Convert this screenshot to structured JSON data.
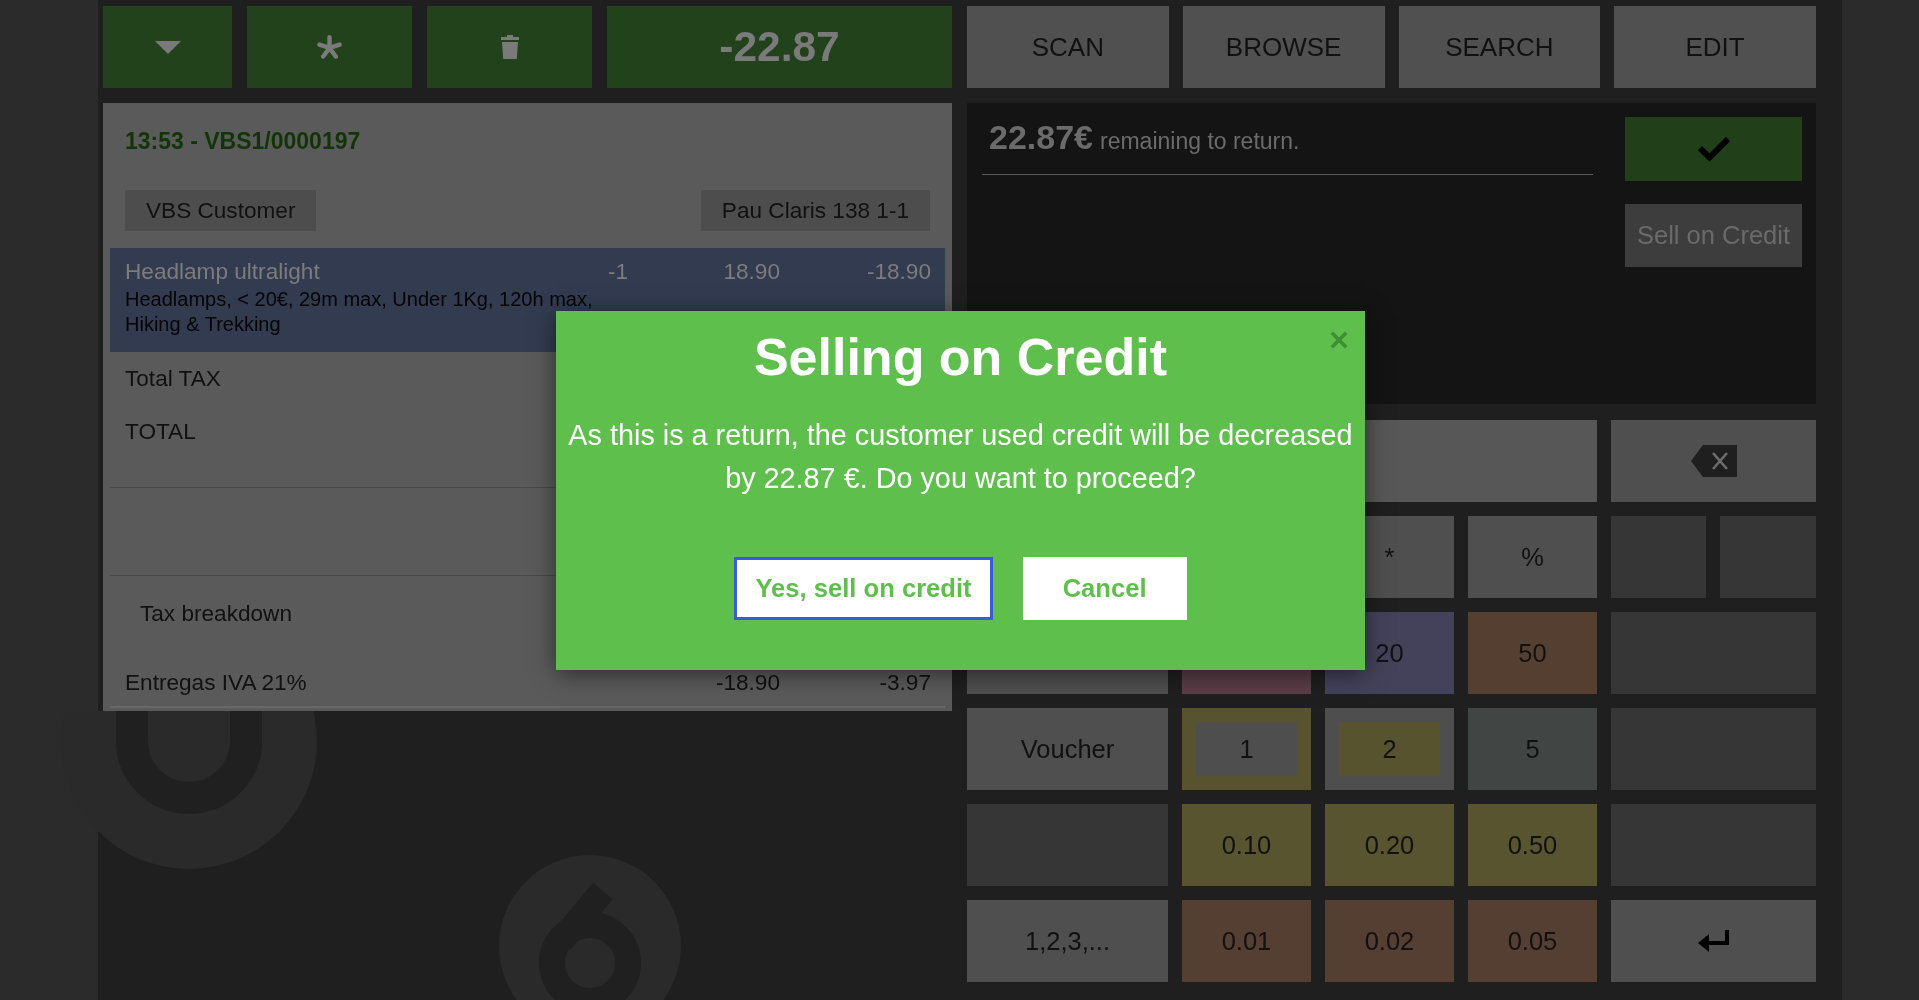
{
  "action_bar": {
    "buttons": [
      {
        "kind": "dropdown"
      },
      {
        "kind": "asterisk"
      },
      {
        "kind": "delete"
      }
    ],
    "amount": "-22.87"
  },
  "navigation": {
    "buttons": [
      "SCAN",
      "BROWSE",
      "SEARCH",
      "EDIT"
    ]
  },
  "order": {
    "title": "13:53 - VBS1/0000197",
    "customer": "VBS Customer",
    "address": "Pau Claris 138 1-1",
    "lines": [
      {
        "product": "Headlamp ultralight",
        "quantity": "-1",
        "price": "18.90",
        "total": "-18.90",
        "note": "Headlamps, < 20€, 29m max, Under 1Kg, 120h max, Hiking & Trekking",
        "selected": true
      }
    ],
    "totals": [
      "Total TAX",
      "TOTAL"
    ],
    "tax_breakdown": {
      "title": "Tax breakdown",
      "rows": [
        {
          "name": "Entregas IVA 21%",
          "base": "-18.90",
          "tax": "-3.97"
        }
      ]
    }
  },
  "payment": {
    "amount": "22.87€",
    "message": "remaining to return.",
    "actions": [
      {
        "kind": "validate"
      },
      {
        "kind": "credit",
        "label": "Sell on Credit"
      }
    ]
  },
  "keypad": {
    "rows": [
      [
        {
          "kind": "key",
          "color": "#575757"
        },
        {
          "kind": "backspace"
        }
      ],
      [
        "",
        "",
        {
          "kind": "key",
          "label": "*"
        },
        {
          "kind": "key",
          "label": "%"
        },
        {
          "kind": "blank"
        },
        {
          "kind": "blank"
        }
      ],
      [
        {
          "kind": "key"
        },
        {
          "kind": "key",
          "color": "#5a3d47"
        },
        {
          "kind": "key",
          "label": "20",
          "color": "#43425a"
        },
        {
          "kind": "key",
          "label": "50",
          "color": "#553f31"
        },
        {
          "kind": "blank"
        }
      ],
      [
        {
          "kind": "key",
          "label": "Voucher"
        },
        {
          "kind": "framed",
          "label": "1",
          "color": "#57532f",
          "face": {
            "color": "#4e4e4e"
          }
        },
        {
          "kind": "framed",
          "label": "2",
          "color": "#4e4e4e",
          "face": {
            "color": "#57532f"
          }
        },
        {
          "kind": "key",
          "label": "5",
          "color": "#414644"
        },
        {
          "kind": "blank"
        }
      ],
      [
        {
          "kind": "blank"
        },
        {
          "kind": "key",
          "label": "0.10",
          "color": "#57542f"
        },
        {
          "kind": "key",
          "label": "0.20",
          "color": "#57542f"
        },
        {
          "kind": "key",
          "label": "0.50",
          "color": "#57542f"
        },
        {
          "kind": "blank"
        }
      ],
      [
        {
          "kind": "key",
          "label": "1,2,3,..."
        },
        {
          "kind": "key",
          "label": "0.01",
          "color": "#553f32"
        },
        {
          "kind": "key",
          "label": "0.02",
          "color": "#553f32"
        },
        {
          "kind": "key",
          "label": "0.05",
          "color": "#553f32"
        },
        {
          "kind": "enter"
        }
      ]
    ]
  },
  "dialog": {
    "title": "Selling on Credit",
    "message": "As this is a return, the customer used credit will be decreased by 22.87 €. Do you want to proceed?",
    "buttons": [
      {
        "label": "Yes, sell on credit",
        "focused": true
      },
      {
        "label": "Cancel",
        "focused": false
      }
    ]
  }
}
